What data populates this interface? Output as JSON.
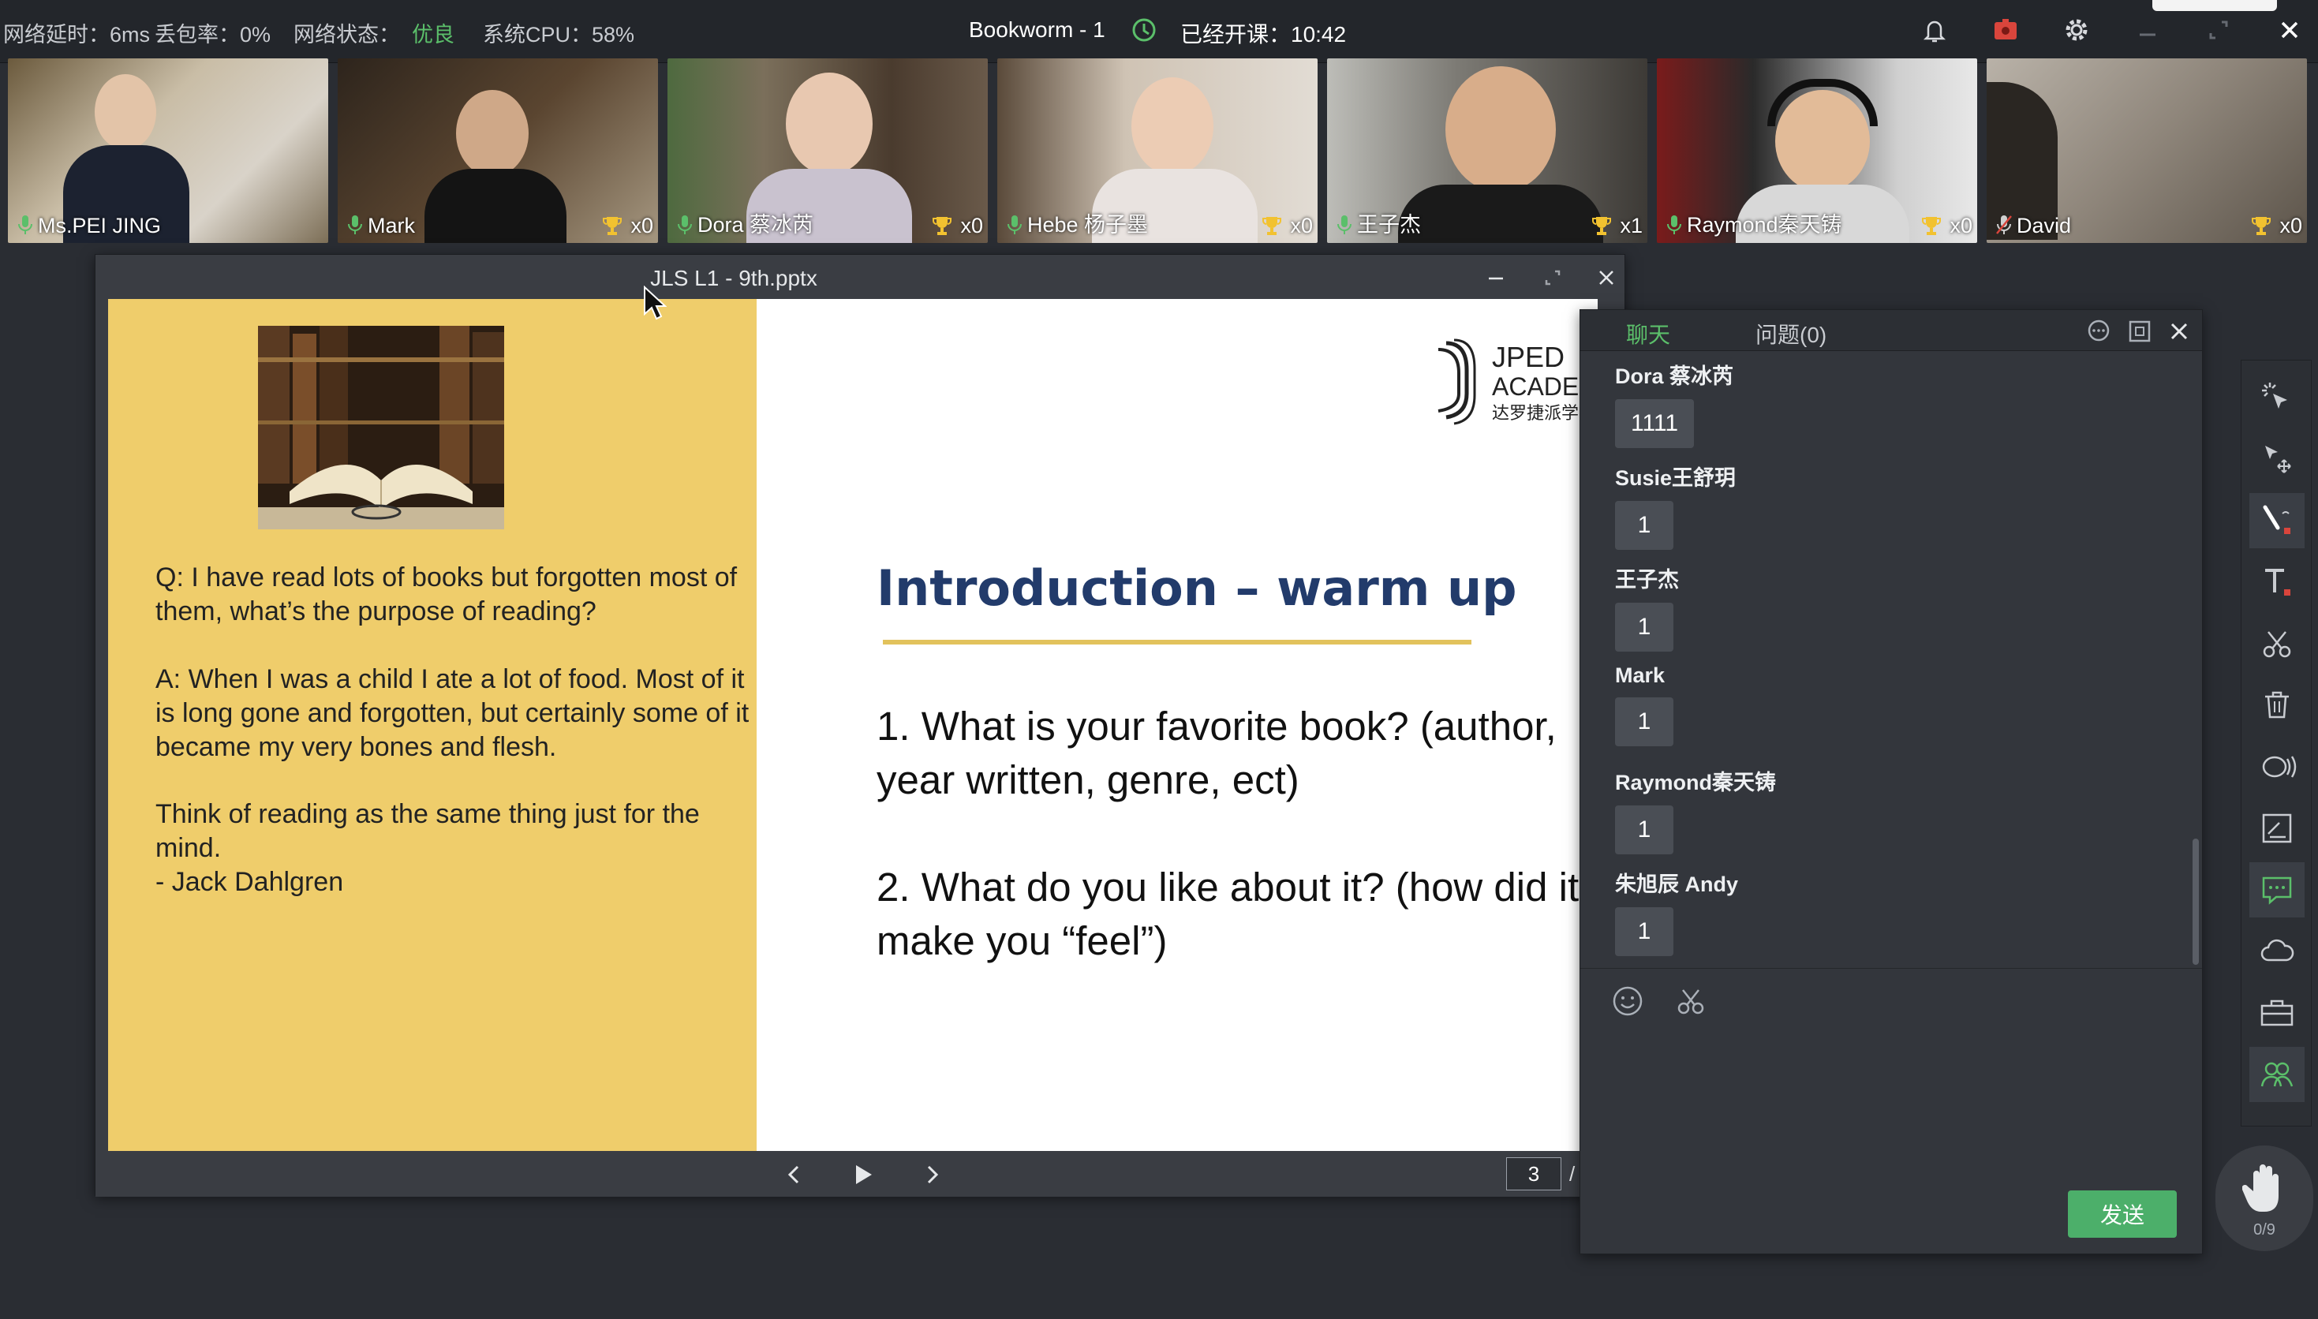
{
  "status_bar": {
    "latency_label": "网络延时：6ms",
    "packet_loss_label": "丢包率：0%",
    "network_label": "网络状态：",
    "network_value": "优良",
    "cpu_label": "系统CPU：58%",
    "class_title": "Bookworm - 1",
    "elapsed_label": "已经开课：10:42"
  },
  "participants": [
    {
      "name": "Ms.PEI JING",
      "count": ""
    },
    {
      "name": "Mark",
      "count": "x0"
    },
    {
      "name": "Dora 蔡冰芮",
      "count": "x0"
    },
    {
      "name": "Hebe 杨子墨",
      "count": "x0"
    },
    {
      "name": "王子杰",
      "count": "x1"
    },
    {
      "name": "Raymond秦天铸",
      "count": "x0"
    },
    {
      "name": "David",
      "count": "x0"
    }
  ],
  "ppt": {
    "window_title": "JLS L1 - 9th.pptx",
    "page_current": "3",
    "page_sep": "/",
    "slide": {
      "question": "Q: I have read lots of books but forgotten most of them, what’s the purpose of reading?",
      "answer": "A: When I was a child I ate a lot of food. Most of it is long gone and forgotten, but certainly some of it became my very bones and flesh.",
      "think": "Think of reading as the same thing just for the mind.",
      "author": "- Jack Dahlgren",
      "title": "Introduction – warm up",
      "q1": "1. What is your favorite book? (author, year written, genre, ect)",
      "q2": "2. What do you like about it? (how did it make you “feel”)",
      "logo_line1": "JPED",
      "logo_line2": "ACADEM",
      "logo_line3": "达罗捷派学"
    }
  },
  "chat": {
    "tab_chat": "聊天",
    "tab_questions": "问题(0)",
    "messages": [
      {
        "sender": "Dora 蔡冰芮",
        "text": "1111"
      },
      {
        "sender": "Susie王舒玥",
        "text": "1"
      },
      {
        "sender": "王子杰",
        "text": "1"
      },
      {
        "sender": "Mark",
        "text": "1"
      },
      {
        "sender": "Raymond秦天铸",
        "text": "1"
      },
      {
        "sender": "朱旭辰 Andy",
        "text": "1"
      }
    ],
    "send_label": "发送"
  },
  "hand_raise_count": "0/9",
  "colors": {
    "accent_green": "#5bbf6a",
    "slide_yellow": "#efcd6b",
    "title_navy": "#223b6b"
  }
}
